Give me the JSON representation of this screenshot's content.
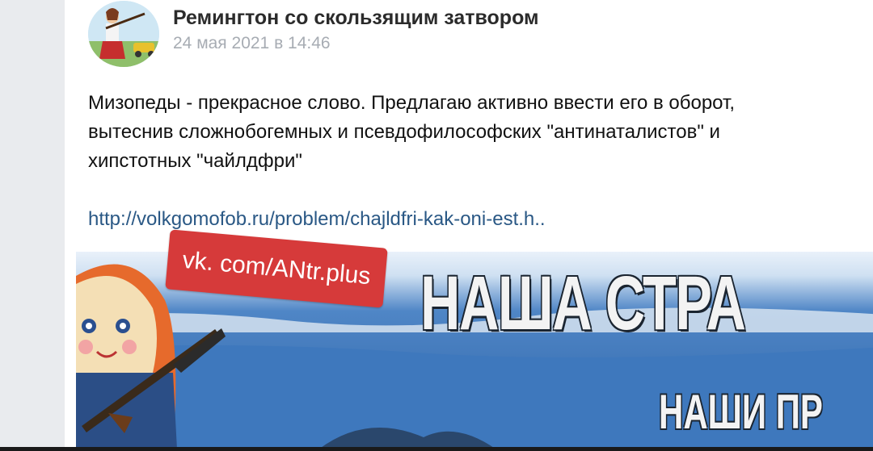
{
  "post": {
    "author": "Ремингтон со скользящим затвором",
    "date": "24 мая 2021 в 14:46",
    "text_lines": [
      "Мизопеды - прекрасное слово. Предлагаю активно ввести его в оборот,",
      "вытеснив сложнобогемных и псевдофилософских \"антинаталистов\" и",
      "хипстотных \"чайлдфри\""
    ],
    "link": "http://volkgomofob.ru/problem/chajldfri-kak-oni-est.h.."
  },
  "attachment": {
    "watermark": "vk. com/ANtr.plus",
    "banner_title": "НАША СТРА",
    "banner_subtitle": "НАШИ ПР"
  },
  "colors": {
    "link": "#2a5885",
    "date": "#a7acb3",
    "watermark_bg": "#d63a3a",
    "sky": "#3b73b8"
  }
}
